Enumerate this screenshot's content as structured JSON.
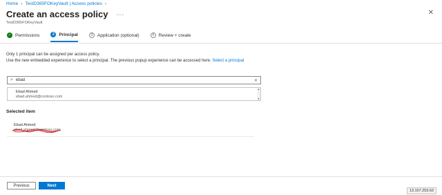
{
  "breadcrumb": [
    "Home",
    "TestD365FOKeyVault | Access policies"
  ],
  "title": "Create an access policy",
  "subtitle": "TestD365FOKeyVault",
  "steps": [
    {
      "label": "Permissions",
      "marker": "✓"
    },
    {
      "label": "Principal",
      "marker": "2"
    },
    {
      "label": "Application (optional)",
      "marker": "3"
    },
    {
      "label": "Review + create",
      "marker": "4"
    }
  ],
  "info": {
    "line1": "Only 1 principal can be assigned per access policy.",
    "line2": "Use the new embedded experience to select a principal. The previous popup experience can be accessed here.",
    "link": "Select a principal"
  },
  "search": {
    "value": "ebad"
  },
  "results": [
    {
      "name": "Ebad Ahmed",
      "email": "ebad.ahmed@contoso.com"
    }
  ],
  "selected": {
    "heading": "Selected item",
    "name": "Ebad Ahmed",
    "email": "ebad.ahmed@contoso.com"
  },
  "buttons": {
    "previous": "Previous",
    "next": "Next"
  },
  "ip": "13.107.253.63",
  "colors": {
    "accent": "#0078d4",
    "success": "#107c10",
    "redaction": "#d13438"
  }
}
